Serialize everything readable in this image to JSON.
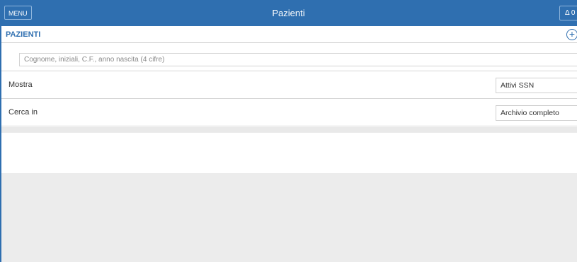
{
  "header": {
    "menu_label": "MENU",
    "title": "Pazienti",
    "notif_text": "Δ 0"
  },
  "section": {
    "title": "PAZIENTI",
    "add_symbol": "+"
  },
  "search": {
    "placeholder": "Cognome, iniziali, C.F., anno nascita (4 cifre)"
  },
  "filters": [
    {
      "label": "Mostra",
      "value": "Attivi SSN"
    },
    {
      "label": "Cerca in",
      "value": "Archivio completo"
    }
  ],
  "colors": {
    "primary": "#2f6fb0",
    "background": "#ececec"
  }
}
